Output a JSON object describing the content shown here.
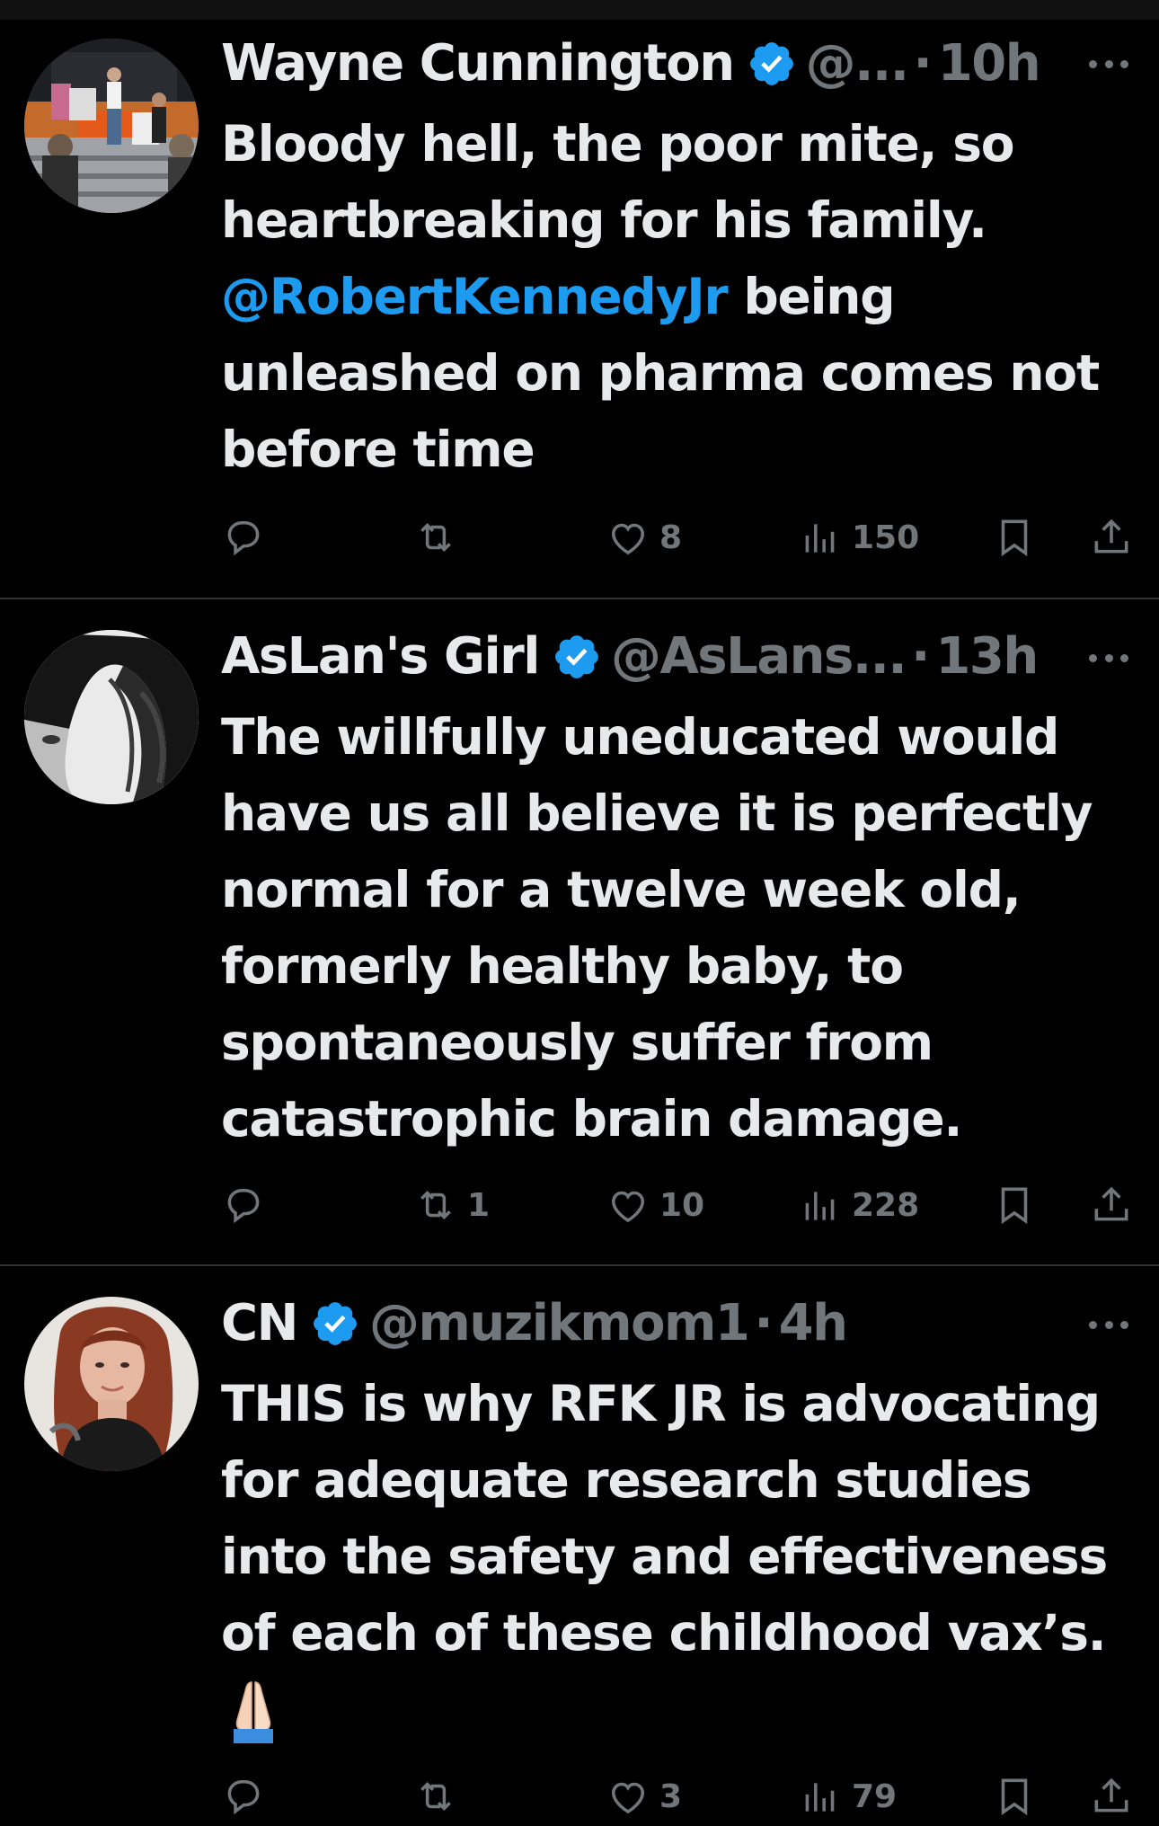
{
  "colors": {
    "background": "#000000",
    "text": "#e7e9ea",
    "muted": "#71767b",
    "accent": "#1d9bf0",
    "divider": "#2f3336"
  },
  "tweets": [
    {
      "name": "Wayne Cunnington",
      "handle": "@...",
      "separator": "·",
      "time": "10h",
      "verified": true,
      "body_lines": [
        {
          "text": "Bloody hell, the poor mite, so"
        },
        {
          "text": "heartbreaking for his family."
        },
        {
          "mention": "@RobertKennedyJr",
          "text": " being"
        },
        {
          "text": "unleashed on pharma comes not"
        },
        {
          "text": "before time"
        }
      ],
      "counts": {
        "reply": "",
        "retweet": "",
        "like": "8",
        "views": "150"
      }
    },
    {
      "name": "AsLan's Girl",
      "handle": "@AsLans...",
      "separator": "·",
      "time": "13h",
      "verified": true,
      "body_lines": [
        {
          "text": "The willfully uneducated would"
        },
        {
          "text": "have us all believe it is perfectly"
        },
        {
          "text": "normal for a twelve week old,"
        },
        {
          "text": "formerly healthy baby, to"
        },
        {
          "text": "spontaneously suffer from"
        },
        {
          "text": "catastrophic brain damage."
        }
      ],
      "counts": {
        "reply": "",
        "retweet": "1",
        "like": "10",
        "views": "228"
      }
    },
    {
      "name": "CN",
      "handle": "@muzikmom1",
      "separator": "·",
      "time": "4h",
      "verified": true,
      "body_lines": [
        {
          "text": "THIS is why RFK JR is advocating"
        },
        {
          "text": "for adequate research studies"
        },
        {
          "text": "into the safety and effectiveness"
        },
        {
          "text": "of each of these childhood vax’s."
        }
      ],
      "emoji": "folded-hands-icon",
      "counts": {
        "reply": "",
        "retweet": "",
        "like": "3",
        "views": "79"
      }
    }
  ]
}
